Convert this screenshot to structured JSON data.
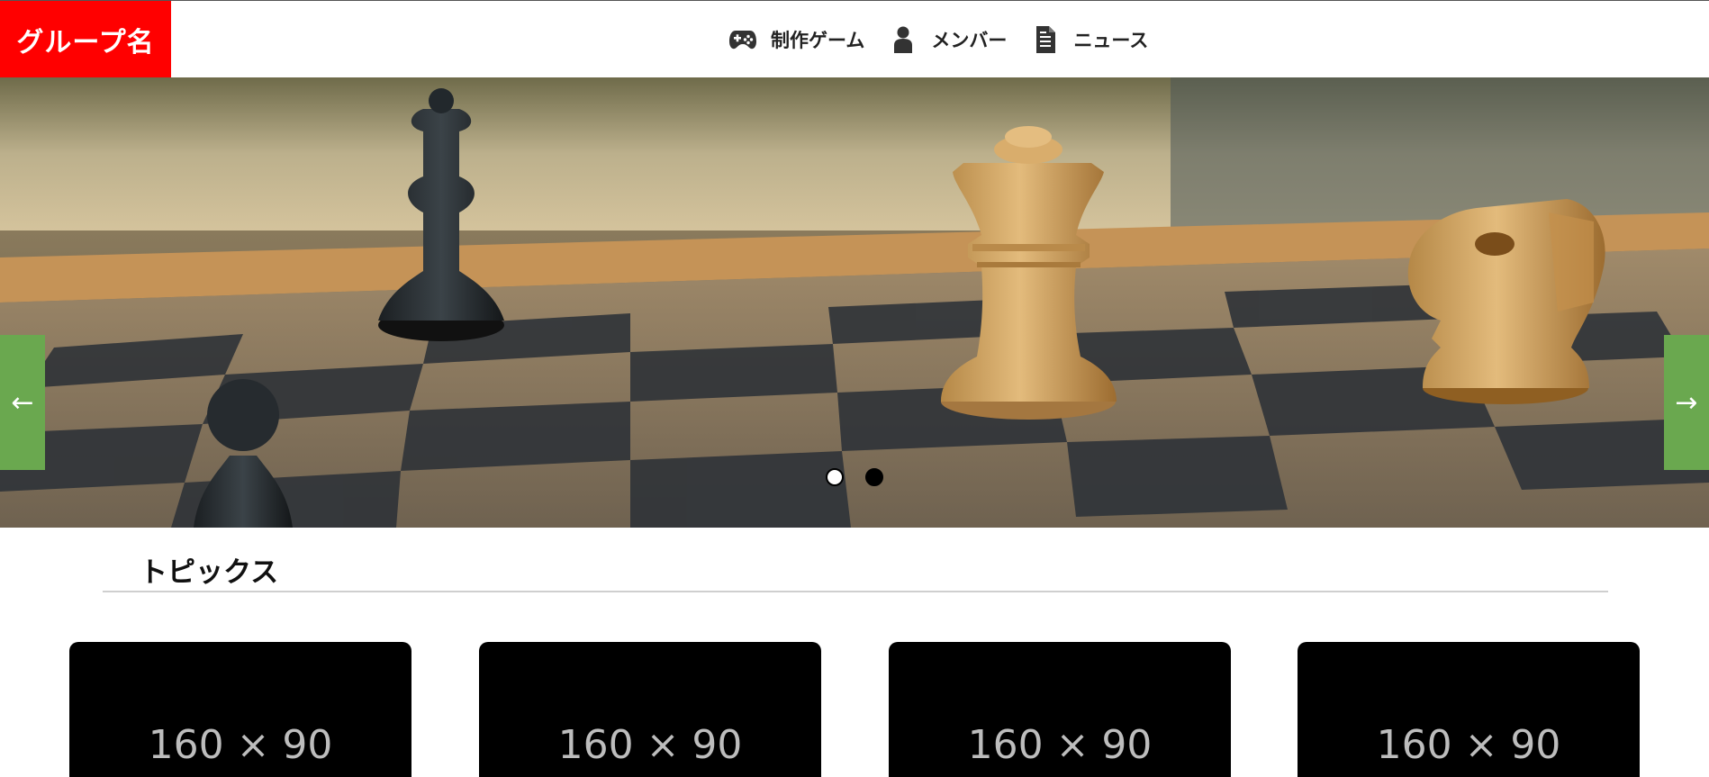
{
  "header": {
    "logo": "グループ名",
    "nav": [
      {
        "label": "制作ゲーム",
        "icon": "gamepad-icon"
      },
      {
        "label": "メンバー",
        "icon": "user-icon"
      },
      {
        "label": "ニュース",
        "icon": "document-icon"
      }
    ]
  },
  "slider": {
    "left_arrow": "←",
    "right_arrow": "→",
    "dots": 2,
    "active_dot": 2
  },
  "topics": {
    "title": "トピックス",
    "cards": [
      {
        "placeholder": "160 × 90"
      },
      {
        "placeholder": "160 × 90"
      },
      {
        "placeholder": "160 × 90"
      },
      {
        "placeholder": "160 × 90"
      }
    ]
  },
  "colors": {
    "logo_bg": "#ff0000",
    "arrow_bg": "#6aa84f",
    "card_bg": "#000000"
  }
}
